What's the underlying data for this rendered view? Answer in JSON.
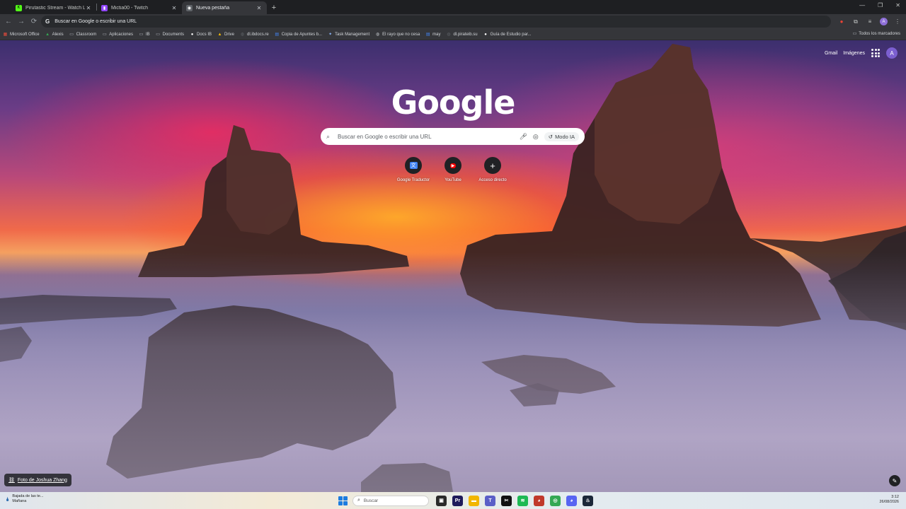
{
  "tabs": [
    {
      "title": "Pirutastic Stream - Watch Live o",
      "favicon_color": "#53fc18",
      "favicon_glyph": "K",
      "active": false
    },
    {
      "title": "Mictia00 - Twitch",
      "favicon_color": "#9146ff",
      "favicon_glyph": "▮",
      "active": false
    },
    {
      "title": "Nueva pestaña",
      "favicon_color": "#5f6368",
      "favicon_glyph": "◉",
      "active": true
    }
  ],
  "toolbar": {
    "omnibox_text": "Buscar en Google o escribir una URL",
    "back_icon": "arrow-left",
    "forward_icon": "arrow-right",
    "reload_icon": "reload",
    "profile_initial": "A"
  },
  "bookmarks": {
    "items": [
      {
        "label": "Microsoft Office",
        "icon": "office-icon",
        "color": "#e74c3c"
      },
      {
        "label": "Alexis",
        "icon": "google-drive-icon",
        "color": "#34a853"
      },
      {
        "label": "Classroom",
        "icon": "folder-icon",
        "color": "#bdc1c6"
      },
      {
        "label": "Aplicaciones",
        "icon": "folder-icon",
        "color": "#bdc1c6"
      },
      {
        "label": "IB",
        "icon": "folder-icon",
        "color": "#bdc1c6"
      },
      {
        "label": "Documents",
        "icon": "folder-icon",
        "color": "#bdc1c6"
      },
      {
        "label": "Docs IB",
        "icon": "github-icon",
        "color": "#ffffff"
      },
      {
        "label": "Drive",
        "icon": "google-drive-icon",
        "color": "#fbbc04"
      },
      {
        "label": "dl.ibdocs.re",
        "icon": "globe-icon",
        "color": "#5f6368"
      },
      {
        "label": "Copia de Apuntes b...",
        "icon": "google-docs-icon",
        "color": "#4285f4"
      },
      {
        "label": "Task Management",
        "icon": "star-icon",
        "color": "#8ab4f8"
      },
      {
        "label": "El rayo que no cesa",
        "icon": "globe-icon",
        "color": "#bdc1c6"
      },
      {
        "label": "may",
        "icon": "google-docs-icon",
        "color": "#4285f4"
      },
      {
        "label": "dl.pirateib.su",
        "icon": "globe-icon",
        "color": "#5f6368"
      },
      {
        "label": "Guía de Estudio par...",
        "icon": "github-icon",
        "color": "#ffffff"
      }
    ],
    "all_bookmarks": "Todos los marcadores"
  },
  "ntp": {
    "gmail": "Gmail",
    "images": "Imágenes",
    "avatar_initial": "A",
    "logo": "Google",
    "search_placeholder": "Buscar en Google o escribir una URL",
    "ai_mode": "Modo IA",
    "shortcuts": [
      {
        "label": "Google Traductor",
        "icon": "translate-icon",
        "color": "#4285f4",
        "glyph": "文"
      },
      {
        "label": "YouTube",
        "icon": "youtube-icon",
        "color": "#ff0000",
        "glyph": "▶"
      },
      {
        "label": "Acceso directo",
        "icon": "plus-icon",
        "color": "#202124",
        "glyph": "+"
      }
    ],
    "photo_credit": "Foto de Joshua Zhang"
  },
  "taskbar": {
    "weather_line1": "Bajada de las te...",
    "weather_line2": "Mañana",
    "search_label": "Buscar",
    "apps": [
      {
        "name": "task-view",
        "color": "#2a2a2a",
        "glyph": "▣"
      },
      {
        "name": "premiere-pro",
        "color": "#1e1a5a",
        "glyph": "Pr"
      },
      {
        "name": "file-explorer",
        "color": "#f2b600",
        "glyph": "▬"
      },
      {
        "name": "teams",
        "color": "#5b5fc7",
        "glyph": "T"
      },
      {
        "name": "capcut",
        "color": "#111111",
        "glyph": "✂"
      },
      {
        "name": "spotify",
        "color": "#1db954",
        "glyph": "≋"
      },
      {
        "name": "discord-red",
        "color": "#c0392b",
        "glyph": "◕"
      },
      {
        "name": "chrome",
        "color": "#34a853",
        "glyph": "◎"
      },
      {
        "name": "discord",
        "color": "#5865f2",
        "glyph": "◕"
      },
      {
        "name": "steam",
        "color": "#1b2838",
        "glyph": "♨"
      }
    ],
    "time": "3:12",
    "date": "26/08/2026"
  }
}
